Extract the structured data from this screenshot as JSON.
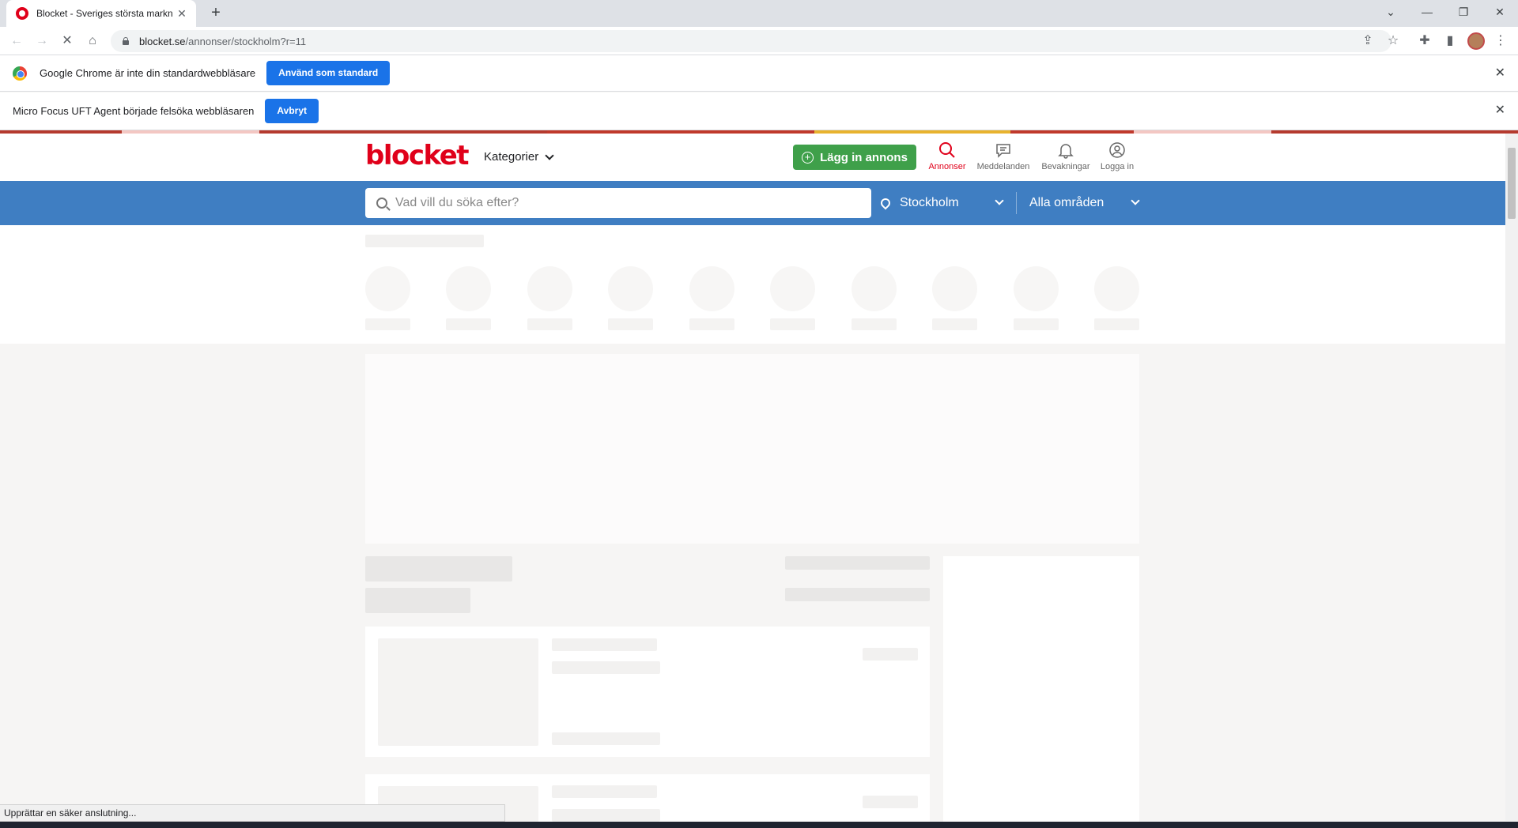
{
  "browser": {
    "tab_title": "Blocket - Sveriges största markn",
    "tab_close": "✕",
    "new_tab": "+",
    "url_host": "blocket.se",
    "url_path": "/annonser/stockholm?r=11",
    "icons": [
      "back-arrow-icon",
      "forward-arrow-icon",
      "stop-loading-icon",
      "home-icon",
      "share-icon",
      "star-icon",
      "extensions-icon",
      "sidepanel-icon",
      "menu-dots-icon"
    ]
  },
  "infobar_default": {
    "message": "Google Chrome är inte din standardwebbläsare",
    "button": "Använd som standard"
  },
  "infobar_debug": {
    "message": "Micro Focus UFT Agent började felsöka webbläsaren",
    "button": "Avbryt"
  },
  "site": {
    "logo": "blocket",
    "categories_label": "Kategorier",
    "post_ad_label": "Lägg in annons",
    "nav": {
      "ads": "Annonser",
      "messages": "Meddelanden",
      "watches": "Bevakningar",
      "login": "Logga in"
    },
    "search_placeholder": "Vad vill du söka efter?",
    "location": "Stockholm",
    "area": "Alla områden",
    "brand_red": "#e0001a",
    "brand_blue": "#3f7ec2",
    "brand_green": "#3fa04a"
  },
  "status": {
    "text": "Upprättar en säker anslutning..."
  }
}
